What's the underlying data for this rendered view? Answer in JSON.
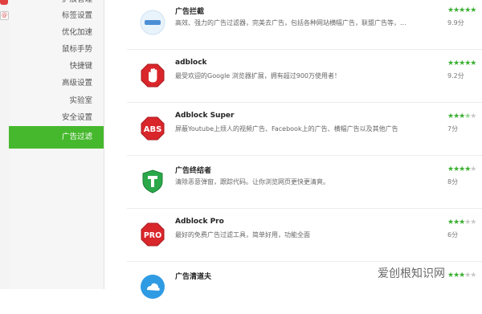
{
  "sidebar": {
    "partial_top_label": "扩展管理",
    "items": [
      {
        "label": "标签设置"
      },
      {
        "label": "优化加速"
      },
      {
        "label": "鼠标手势"
      },
      {
        "label": "快捷键"
      },
      {
        "label": "高级设置"
      },
      {
        "label": "实验室"
      },
      {
        "label": "安全设置"
      },
      {
        "label": "广告过滤",
        "active": true
      }
    ]
  },
  "colors": {
    "accent_green": "#46b82d",
    "star_green": "#3bb031"
  },
  "extensions": [
    {
      "icon": "minus-bar-icon",
      "title": "广告拦截",
      "desc": "高效、强力的广告过滤器，完美去广告，包括各种网站横幅广告，联盟广告等，...",
      "rating": 5,
      "score": "9.9分"
    },
    {
      "icon": "stop-hand-icon",
      "title": "adblock",
      "desc": "最受欢迎的Google 浏览器扩展，拥有超过900万使用者！",
      "rating": 5,
      "score": "9.2分"
    },
    {
      "icon": "abs-octagon-icon",
      "title": "Adblock Super",
      "desc": "屏蔽Youtube上烦人的视频广告、Facebook上的广告、横幅广告以及其他广告",
      "rating": 3.5,
      "score": "7分"
    },
    {
      "icon": "t-shield-icon",
      "title": "广告终结者",
      "desc": "清除恶意弹窗，跟踪代码。让你浏览网页更快更清爽。",
      "rating": 4,
      "score": "8分"
    },
    {
      "icon": "pro-octagon-icon",
      "title": "Adblock Pro",
      "desc": "最好的免费广告过滤工具，简单好用，功能全面",
      "rating": 3,
      "score": "6分"
    },
    {
      "icon": "blue-cloud-icon",
      "title": "广告清道夫",
      "desc": "",
      "rating": 3,
      "score": ""
    }
  ],
  "watermark": "爱创根知识网"
}
